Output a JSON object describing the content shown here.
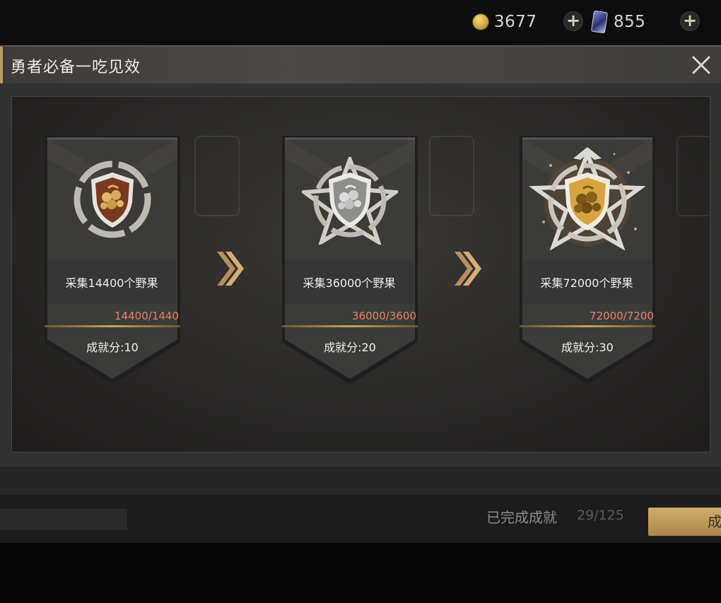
{
  "topbar": {
    "gold_icon": "gold-coin-icon",
    "gold_value": "3677",
    "card_icon": "card-currency-icon",
    "card_value": "855",
    "plus_icon": "plus-icon"
  },
  "background": {
    "completed_label": "已完成成就",
    "completed_count": "29/125",
    "gold_button_label": "成",
    "tab_text": "..."
  },
  "modal": {
    "title": "勇者必备一吃见效",
    "close_icon": "close-icon"
  },
  "achievements": [
    {
      "task": "采集14400个野果",
      "progress": "14400/1440",
      "score": "成就分:10",
      "tier": "bronze"
    },
    {
      "task": "采集36000个野果",
      "progress": "36000/3600",
      "score": "成就分:20",
      "tier": "silver"
    },
    {
      "task": "采集72000个野果",
      "progress": "72000/7200",
      "score": "成就分:30",
      "tier": "gold"
    }
  ],
  "colors": {
    "progress_text": "#e8836a",
    "accent_gold": "#c8a14f",
    "arrow": "#c9a06a",
    "bronze": "#7a3a20",
    "silver": "#9a9a9a",
    "gold": "#d8a440"
  }
}
